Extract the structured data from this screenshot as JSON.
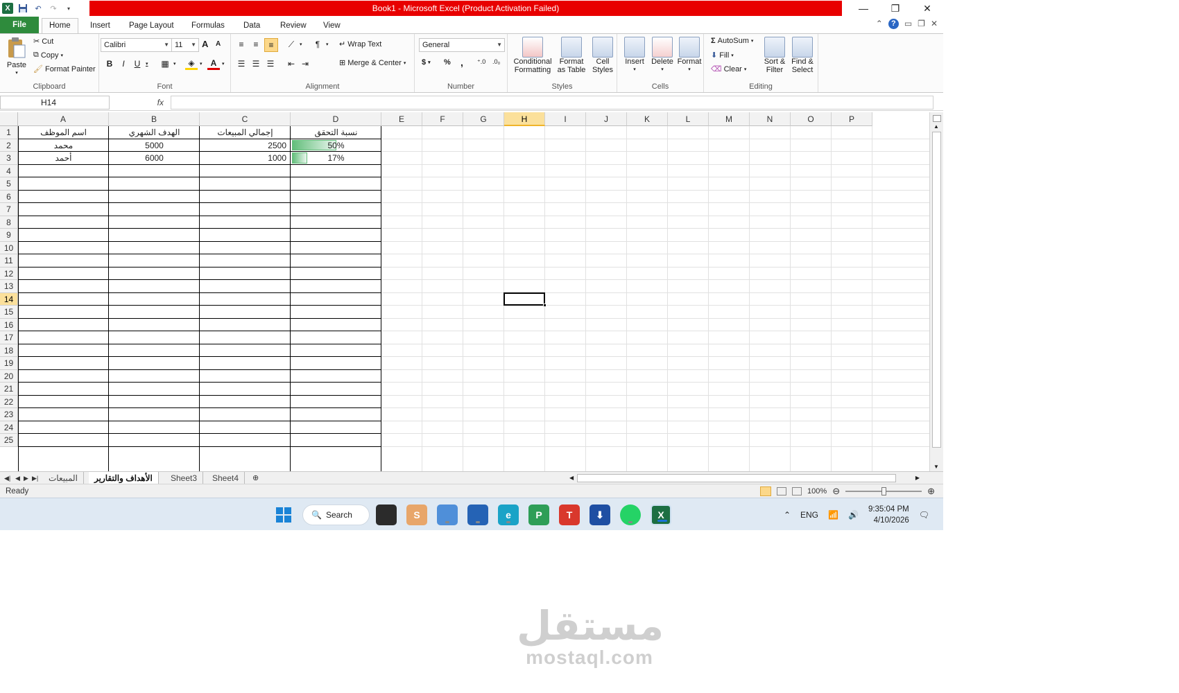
{
  "title": "Book1  -  Microsoft Excel (Product Activation Failed)",
  "icons": {
    "logo": "excel-logo-icon",
    "save": "save-icon",
    "undo": "undo-icon",
    "redo": "redo-icon",
    "customize": "customize-qat-icon"
  },
  "window_controls": {
    "minimize": "—",
    "restore": "❐",
    "close": "✕"
  },
  "tabs": [
    "File",
    "Home",
    "Insert",
    "Page Layout",
    "Formulas",
    "Data",
    "Review",
    "View"
  ],
  "active_tab": "Home",
  "ribbon": {
    "clipboard": {
      "label": "Clipboard",
      "paste": "Paste",
      "cut": "Cut",
      "copy": "Copy",
      "format_painter": "Format Painter"
    },
    "font": {
      "label": "Font",
      "name": "Calibri",
      "size": "11",
      "bold": "B",
      "italic": "I",
      "underline": "U",
      "font_color_letter": "A",
      "grow": "A",
      "shrink": "A"
    },
    "alignment": {
      "label": "Alignment",
      "wrap_text": "Wrap Text",
      "merge_center": "Merge & Center"
    },
    "number": {
      "label": "Number",
      "format": "General",
      "currency": "$",
      "percent": "%",
      "comma": ","
    },
    "styles": {
      "label": "Styles",
      "conditional_1": "Conditional",
      "conditional_2": "Formatting",
      "format_table_1": "Format",
      "format_table_2": "as Table",
      "cell_styles_1": "Cell",
      "cell_styles_2": "Styles"
    },
    "cells": {
      "label": "Cells",
      "insert": "Insert",
      "delete": "Delete",
      "format": "Format"
    },
    "editing": {
      "label": "Editing",
      "autosum": "AutoSum",
      "fill": "Fill",
      "clear": "Clear",
      "sort_1": "Sort &",
      "sort_2": "Filter",
      "find_1": "Find &",
      "find_2": "Select"
    }
  },
  "name_box": "H14",
  "fx": "fx",
  "columns": [
    "A",
    "B",
    "C",
    "D",
    "E",
    "F",
    "G",
    "H",
    "I",
    "J",
    "K",
    "L",
    "M",
    "N",
    "O",
    "P"
  ],
  "rows": [
    "1",
    "2",
    "3",
    "4",
    "5",
    "6",
    "7",
    "8",
    "9",
    "10",
    "11",
    "12",
    "13",
    "14",
    "15",
    "16",
    "17",
    "18",
    "19",
    "20",
    "21",
    "22",
    "23",
    "24",
    "25"
  ],
  "selected_column": "H",
  "selected_row": "14",
  "table": {
    "headers": [
      "اسم الموظف",
      "الهدف الشهري",
      "إجمالي المبيعات",
      "نسبة التحقق"
    ],
    "rows": [
      {
        "name": "محمد",
        "target": "5000",
        "sales": "2500",
        "ratio": "50%",
        "ratio_value": 0.5
      },
      {
        "name": "أحمد",
        "target": "6000",
        "sales": "1000",
        "ratio": "17%",
        "ratio_value": 0.17
      }
    ]
  },
  "sheets": [
    "المبيعات",
    "الأهداف والتقارير",
    "Sheet3",
    "Sheet4"
  ],
  "active_sheet": "الأهداف والتقارير",
  "status": "Ready",
  "zoom": "100%",
  "taskbar": {
    "search": "Search",
    "language": "ENG",
    "time": "9:35:04 PM",
    "date": "4/10/2026"
  },
  "watermark": {
    "arabic": "مستقل",
    "latin": "mostaql.com"
  }
}
